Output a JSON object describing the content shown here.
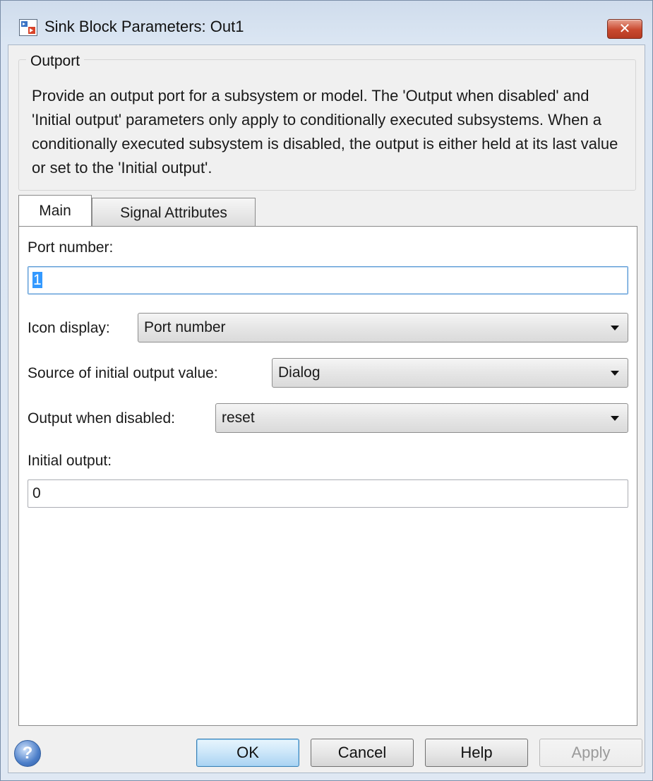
{
  "window": {
    "title": "Sink Block Parameters: Out1",
    "close_glyph": "✕"
  },
  "group": {
    "legend": "Outport",
    "description": "Provide an output port for a subsystem or model.  The 'Output when disabled' and 'Initial output' parameters only apply to conditionally executed subsystems. When a conditionally executed subsystem is disabled, the output is either held at its last value or set to the 'Initial output'."
  },
  "tabs": [
    {
      "label": "Main",
      "active": true
    },
    {
      "label": "Signal Attributes",
      "active": false
    }
  ],
  "main": {
    "port_number_label": "Port number:",
    "port_number_value": "1",
    "icon_display_label": "Icon display:",
    "icon_display_value": "Port number",
    "source_label": "Source of initial output value:",
    "source_value": "Dialog",
    "output_disabled_label": "Output when disabled:",
    "output_disabled_value": "reset",
    "initial_output_label": "Initial output:",
    "initial_output_value": "0"
  },
  "buttons": {
    "ok": "OK",
    "cancel": "Cancel",
    "help": "Help",
    "apply": "Apply",
    "help_icon": "?"
  },
  "colors": {
    "close_button": "#c9492e",
    "default_button": "#cbe6f9",
    "selection": "#3399ff"
  }
}
